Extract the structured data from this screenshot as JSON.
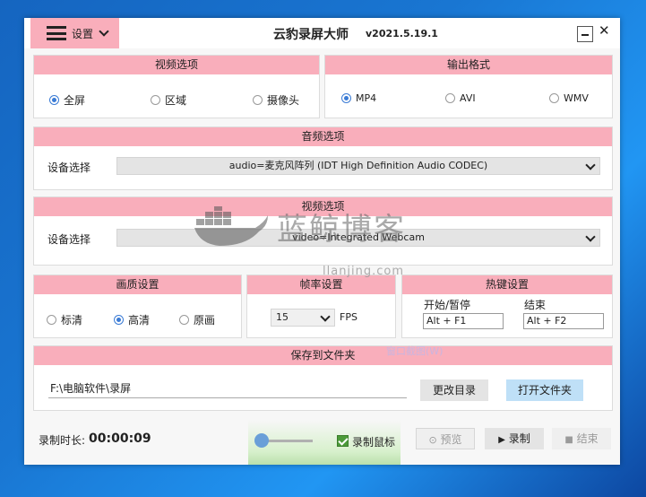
{
  "titlebar": {
    "menu_label": "设置",
    "title": "云豹录屏大师",
    "version": "v2021.5.19.1",
    "close_glyph": "✕"
  },
  "video_options": {
    "header": "视频选项",
    "options": [
      "全屏",
      "区域",
      "摄像头"
    ],
    "selected": 0
  },
  "output_format": {
    "header": "输出格式",
    "options": [
      "MP4",
      "AVI",
      "WMV"
    ],
    "selected": 0
  },
  "audio_options": {
    "header": "音频选项",
    "device_label": "设备选择",
    "device_value": "audio=麦克风阵列 (IDT High Definition Audio CODEC)"
  },
  "video_device": {
    "header": "视频选项",
    "device_label": "设备选择",
    "device_value": "video=Integrated Webcam"
  },
  "quality": {
    "header": "画质设置",
    "options": [
      "标清",
      "高清",
      "原画"
    ],
    "selected": 1
  },
  "framerate": {
    "header": "帧率设置",
    "value": "15",
    "unit": "FPS"
  },
  "hotkeys": {
    "header": "热键设置",
    "start_label": "开始/暂停",
    "start_value": "Alt + F1",
    "end_label": "结束",
    "end_value": "Alt + F2"
  },
  "save": {
    "header": "保存到文件夹",
    "path": "F:\\电脑软件\\录屏",
    "change_dir": "更改目录",
    "open_folder": "打开文件夹"
  },
  "watermark": {
    "text": "蓝鲸博客",
    "sub": "llanjing.com",
    "ghost": "窗口截图(W)"
  },
  "bottom": {
    "duration_label": "录制时长:",
    "duration_value": "00:00:09",
    "record_mouse": "录制鼠标",
    "preview": "预览",
    "record": "录制",
    "stop": "结束"
  },
  "colors": {
    "accent_pink": "#f9aebb",
    "active_button": "#bfe0f7",
    "radio_blue": "#3a7bd5"
  }
}
